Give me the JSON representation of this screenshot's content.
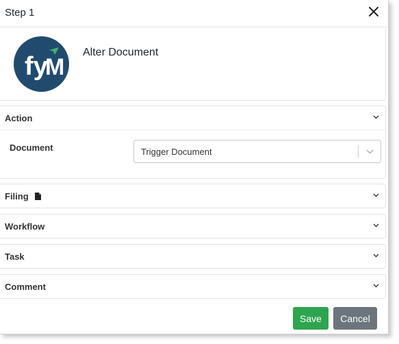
{
  "dialog": {
    "title": "Step 1",
    "heading": "Alter Document",
    "logo_text": "fy",
    "colors": {
      "logo_bg": "#214b6e",
      "logo_accent": "#3fb56d",
      "save": "#2ea44f",
      "cancel": "#6c757d"
    }
  },
  "sections": {
    "action": {
      "label": "Action",
      "field_label": "Document",
      "select_value": "Trigger Document"
    },
    "filing": {
      "label": "Filing"
    },
    "workflow": {
      "label": "Workflow"
    },
    "task": {
      "label": "Task"
    },
    "comment": {
      "label": "Comment"
    }
  },
  "footer": {
    "save_label": "Save",
    "cancel_label": "Cancel"
  }
}
